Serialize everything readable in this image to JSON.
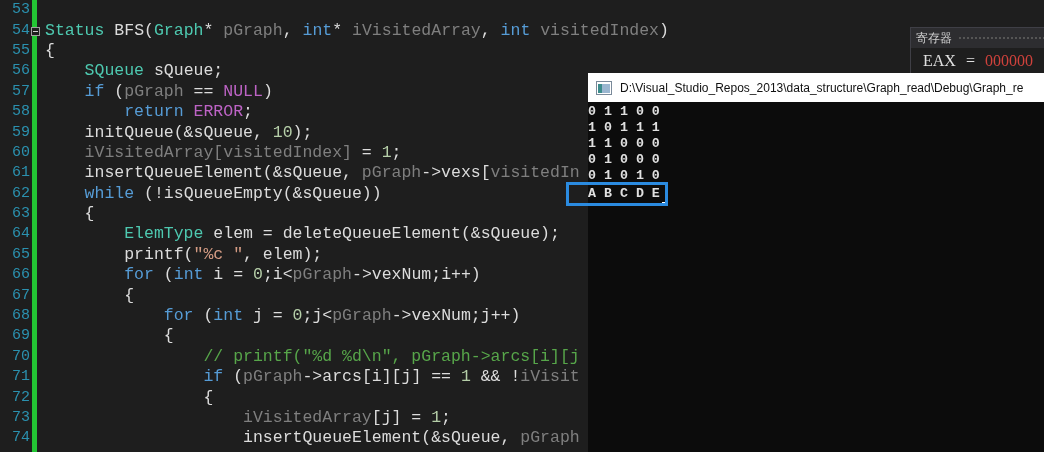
{
  "editor": {
    "lines": [
      {
        "number": "53",
        "fold": false
      },
      {
        "number": "54",
        "fold": true,
        "tokens": [
          {
            "kind": "type",
            "text": "Status"
          },
          {
            "kind": "plain",
            "text": " BFS("
          },
          {
            "kind": "type",
            "text": "Graph"
          },
          {
            "kind": "plain",
            "text": "* "
          },
          {
            "kind": "param",
            "text": "pGraph"
          },
          {
            "kind": "plain",
            "text": ", "
          },
          {
            "kind": "keyword",
            "text": "int"
          },
          {
            "kind": "plain",
            "text": "* "
          },
          {
            "kind": "param",
            "text": "iVisitedArray"
          },
          {
            "kind": "plain",
            "text": ", "
          },
          {
            "kind": "keyword",
            "text": "int"
          },
          {
            "kind": "param",
            "text": " visitedIndex"
          },
          {
            "kind": "plain",
            "text": ")"
          }
        ]
      },
      {
        "number": "55",
        "fold": false,
        "tokens": [
          {
            "kind": "plain",
            "text": "{"
          }
        ]
      },
      {
        "number": "56",
        "fold": false,
        "tokens": [
          {
            "kind": "type",
            "text": "    SQueue"
          },
          {
            "kind": "plain",
            "text": " sQueue;"
          }
        ]
      },
      {
        "number": "57",
        "fold": false,
        "tokens": [
          {
            "kind": "keyword",
            "text": "    if"
          },
          {
            "kind": "plain",
            "text": " ("
          },
          {
            "kind": "param",
            "text": "pGraph"
          },
          {
            "kind": "plain",
            "text": " == "
          },
          {
            "kind": "macro",
            "text": "NULL"
          },
          {
            "kind": "plain",
            "text": ")"
          }
        ]
      },
      {
        "number": "58",
        "fold": false,
        "tokens": [
          {
            "kind": "keyword",
            "text": "        return"
          },
          {
            "kind": "macro",
            "text": " ERROR"
          },
          {
            "kind": "plain",
            "text": ";"
          }
        ]
      },
      {
        "number": "59",
        "fold": false,
        "tokens": [
          {
            "kind": "plain",
            "text": "    initQueue(&sQueue, "
          },
          {
            "kind": "number",
            "text": "10"
          },
          {
            "kind": "plain",
            "text": ");"
          }
        ]
      },
      {
        "number": "60",
        "fold": false,
        "tokens": [
          {
            "kind": "param",
            "text": "    iVisitedArray[visitedIndex]"
          },
          {
            "kind": "plain",
            "text": " = "
          },
          {
            "kind": "number",
            "text": "1"
          },
          {
            "kind": "plain",
            "text": ";"
          }
        ]
      },
      {
        "number": "61",
        "fold": false,
        "tokens": [
          {
            "kind": "plain",
            "text": "    insertQueueElement(&sQueue, "
          },
          {
            "kind": "param",
            "text": "pGraph"
          },
          {
            "kind": "plain",
            "text": "->vexs["
          },
          {
            "kind": "param",
            "text": "visitedIn"
          }
        ]
      },
      {
        "number": "62",
        "fold": false,
        "tokens": [
          {
            "kind": "keyword",
            "text": "    while"
          },
          {
            "kind": "plain",
            "text": " (!isQueueEmpty(&sQueue))"
          }
        ]
      },
      {
        "number": "63",
        "fold": false,
        "tokens": [
          {
            "kind": "plain",
            "text": "    {"
          }
        ]
      },
      {
        "number": "64",
        "fold": false,
        "tokens": [
          {
            "kind": "type",
            "text": "        ElemType"
          },
          {
            "kind": "plain",
            "text": " elem = deleteQueueElement(&sQueue);"
          }
        ]
      },
      {
        "number": "65",
        "fold": false,
        "tokens": [
          {
            "kind": "plain",
            "text": "        printf("
          },
          {
            "kind": "string",
            "text": "\"%c \""
          },
          {
            "kind": "plain",
            "text": ", elem);"
          }
        ]
      },
      {
        "number": "66",
        "fold": false,
        "tokens": [
          {
            "kind": "keyword",
            "text": "        for"
          },
          {
            "kind": "plain",
            "text": " ("
          },
          {
            "kind": "keyword",
            "text": "int"
          },
          {
            "kind": "plain",
            "text": " i = "
          },
          {
            "kind": "number",
            "text": "0"
          },
          {
            "kind": "plain",
            "text": ";i<"
          },
          {
            "kind": "param",
            "text": "pGraph"
          },
          {
            "kind": "plain",
            "text": "->vexNum;i++)"
          }
        ]
      },
      {
        "number": "67",
        "fold": false,
        "tokens": [
          {
            "kind": "plain",
            "text": "        {"
          }
        ]
      },
      {
        "number": "68",
        "fold": false,
        "tokens": [
          {
            "kind": "keyword",
            "text": "            for"
          },
          {
            "kind": "plain",
            "text": " ("
          },
          {
            "kind": "keyword",
            "text": "int"
          },
          {
            "kind": "plain",
            "text": " j = "
          },
          {
            "kind": "number",
            "text": "0"
          },
          {
            "kind": "plain",
            "text": ";j<"
          },
          {
            "kind": "param",
            "text": "pGraph"
          },
          {
            "kind": "plain",
            "text": "->vexNum;j++)"
          }
        ]
      },
      {
        "number": "69",
        "fold": false,
        "tokens": [
          {
            "kind": "plain",
            "text": "            {"
          }
        ]
      },
      {
        "number": "70",
        "fold": false,
        "tokens": [
          {
            "kind": "comment",
            "text": "                // printf(\"%d %d\\n\", pGraph->arcs[i][j"
          }
        ]
      },
      {
        "number": "71",
        "fold": false,
        "tokens": [
          {
            "kind": "keyword",
            "text": "                if"
          },
          {
            "kind": "plain",
            "text": " ("
          },
          {
            "kind": "param",
            "text": "pGraph"
          },
          {
            "kind": "plain",
            "text": "->arcs[i][j] == "
          },
          {
            "kind": "number",
            "text": "1"
          },
          {
            "kind": "plain",
            "text": " && !"
          },
          {
            "kind": "param",
            "text": "iVisit"
          }
        ]
      },
      {
        "number": "72",
        "fold": false,
        "tokens": [
          {
            "kind": "plain",
            "text": "                {"
          }
        ]
      },
      {
        "number": "73",
        "fold": false,
        "tokens": [
          {
            "kind": "param",
            "text": "                    iVisitedArray"
          },
          {
            "kind": "plain",
            "text": "[j] = "
          },
          {
            "kind": "number",
            "text": "1"
          },
          {
            "kind": "plain",
            "text": ";"
          }
        ]
      },
      {
        "number": "74",
        "fold": false,
        "tokens": [
          {
            "kind": "plain",
            "text": "                    insertQueueElement(&sQueue, "
          },
          {
            "kind": "param",
            "text": "pGraph"
          }
        ]
      }
    ]
  },
  "registers": {
    "title": "寄存器",
    "rows": [
      {
        "name": "EAX",
        "equals": "=",
        "value": "000000"
      }
    ]
  },
  "console": {
    "title": "D:\\Visual_Studio_Repos_2013\\data_structure\\Graph_read\\Debug\\Graph_re",
    "output": [
      {
        "text": "0 1 1 0 0",
        "highlighted": false
      },
      {
        "text": "1 0 1 1 1",
        "highlighted": false
      },
      {
        "text": "1 1 0 0 0",
        "highlighted": false
      },
      {
        "text": "0 1 0 0 0",
        "highlighted": false
      },
      {
        "text": "0 1 0 1 0",
        "highlighted": false
      },
      {
        "text": "A B C D E",
        "highlighted": true
      }
    ]
  }
}
